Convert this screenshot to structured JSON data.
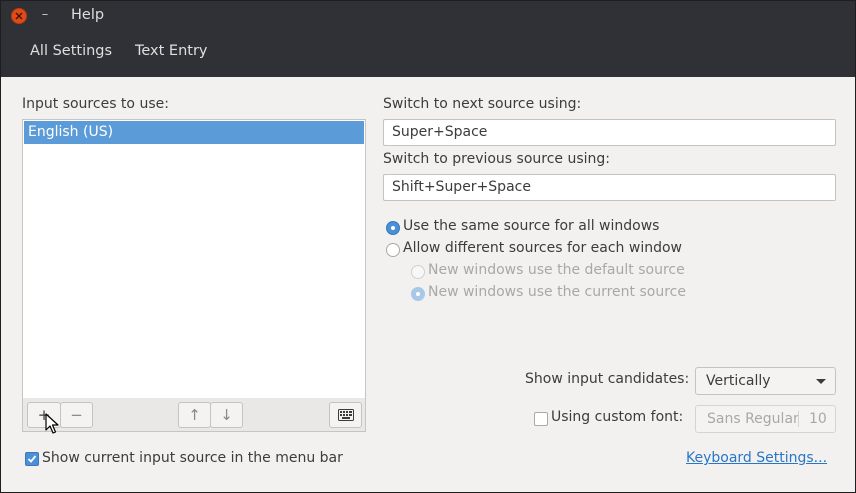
{
  "titlebar": {
    "menu": "Help",
    "tabs": [
      {
        "label": "All Settings"
      },
      {
        "label": "Text Entry"
      }
    ]
  },
  "sources": {
    "label": "Input sources to use:",
    "items": [
      "English (US)"
    ],
    "toolbar": {
      "add": "+",
      "remove": "−",
      "up": "↑",
      "down": "↓"
    }
  },
  "switching": {
    "next_label": "Switch to next source using:",
    "next_value": "Super+Space",
    "prev_label": "Switch to previous source using:",
    "prev_value": "Shift+Super+Space"
  },
  "source_mode": {
    "same": "Use the same source for all windows",
    "different": "Allow different sources for each window",
    "new_default": "New windows use the default source",
    "new_current": "New windows use the current source"
  },
  "candidates": {
    "label": "Show input candidates:",
    "value": "Vertically"
  },
  "custom_font": {
    "label": "Using custom font:",
    "font": "Sans Regular",
    "size": "10"
  },
  "indicator": {
    "label": "Show current input source in the menu bar"
  },
  "keyboard_settings_link": "Keyboard Settings...",
  "colors": {
    "accent": "#4a90d9",
    "selection": "#5b9bd8",
    "titlebar": "#2f3136",
    "close": "#df4a16",
    "link": "#2a76c6"
  }
}
